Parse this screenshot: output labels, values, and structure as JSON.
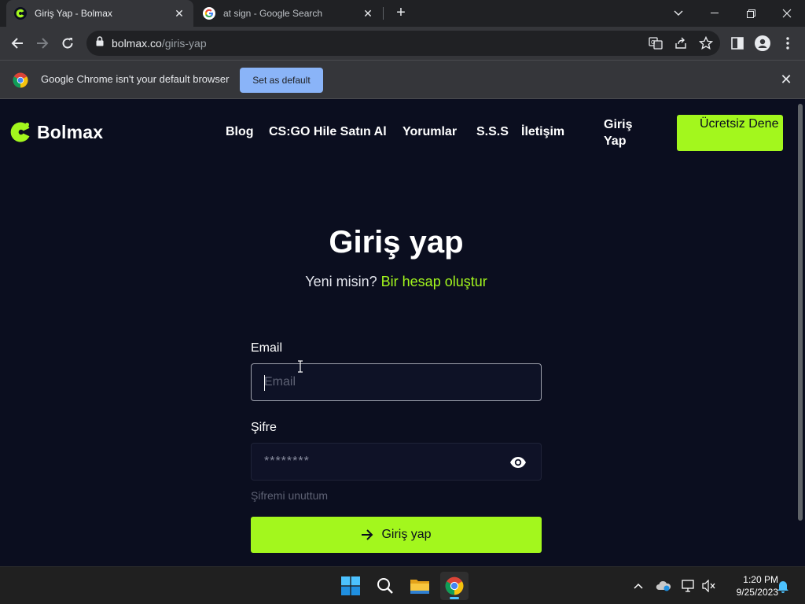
{
  "browser": {
    "tabs": [
      {
        "title": "Giriş Yap - Bolmax",
        "active": true
      },
      {
        "title": "at sign - Google Search",
        "active": false
      }
    ],
    "url_host": "bolmax.co",
    "url_path": "/giris-yap",
    "infobar": {
      "message": "Google Chrome isn't your default browser",
      "button": "Set as default"
    }
  },
  "site": {
    "brand": "Bolmax",
    "nav": [
      "Blog",
      "CS:GO Hile Satın Al",
      "Yorumlar",
      "S.S.S",
      "İletişim"
    ],
    "login_link": "Giriş Yap",
    "trial_button": "Ücretsiz Dene",
    "accent_color": "#a3f71d"
  },
  "form": {
    "heading": "Giriş yap",
    "subtitle_prefix": "Yeni misin?",
    "subtitle_link": "Bir hesap oluştur",
    "email_label": "Email",
    "email_placeholder": "Email",
    "password_label": "Şifre",
    "password_placeholder": "********",
    "forgot": "Şifremi unuttum",
    "submit": "Giriş yap"
  },
  "taskbar": {
    "time": "1:20 PM",
    "date": "9/25/2023"
  }
}
